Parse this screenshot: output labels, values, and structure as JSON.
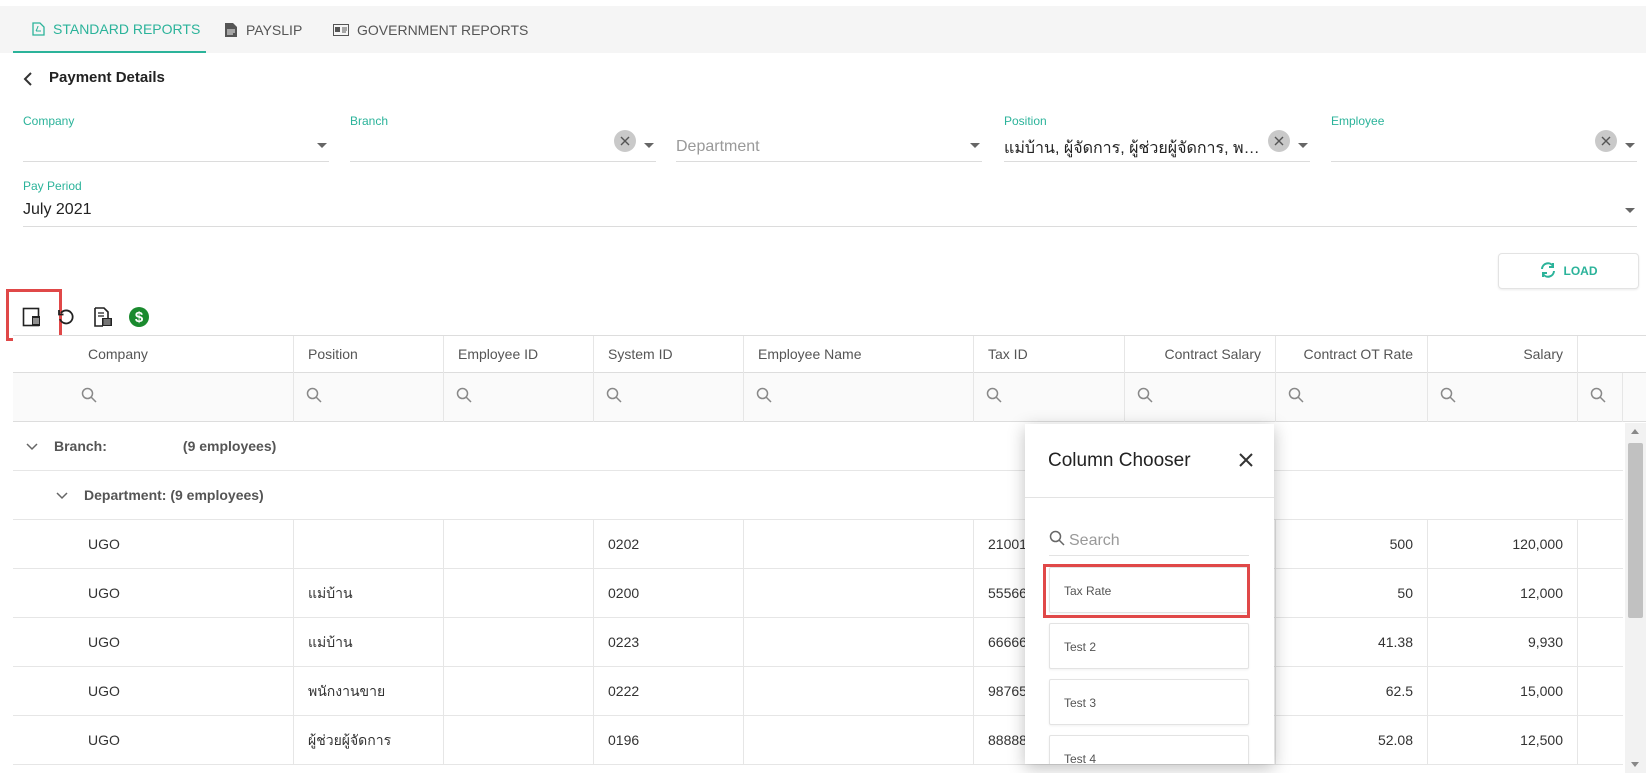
{
  "tabs": [
    {
      "label": "STANDARD REPORTS",
      "icon": "pdf-file-icon",
      "active": true
    },
    {
      "label": "PAYSLIP",
      "icon": "document-icon",
      "active": false
    },
    {
      "label": "GOVERNMENT REPORTS",
      "icon": "id-card-icon",
      "active": false
    }
  ],
  "header": {
    "title": "Payment Details"
  },
  "filters": {
    "company": {
      "label": "Company",
      "value": ""
    },
    "branch": {
      "label": "Branch",
      "value": ""
    },
    "department": {
      "placeholder": "Department"
    },
    "position": {
      "label": "Position",
      "value": "แม่บ้าน, ผู้จัดการ, ผู้ช่วยผู้จัดการ, พนักง…"
    },
    "employee": {
      "label": "Employee",
      "value": ""
    },
    "pay_period": {
      "label": "Pay Period",
      "value": "July 2021"
    }
  },
  "load_button": {
    "label": "LOAD"
  },
  "grid": {
    "columns": [
      "Company",
      "Position",
      "Employee ID",
      "System ID",
      "Employee Name",
      "Tax ID",
      "Contract Salary",
      "Contract OT Rate",
      "Salary"
    ],
    "group_branch": {
      "label": "Branch:",
      "count": "(9 employees)"
    },
    "group_department": {
      "label": "Department: (9 employees)"
    },
    "rows": [
      {
        "company": "UGO",
        "position": "",
        "employee_id": "",
        "system_id": "0202",
        "employee_name": "",
        "tax_id": "21001",
        "contract_salary": "",
        "ot_rate": "500",
        "salary": "120,000"
      },
      {
        "company": "UGO",
        "position": "แม่บ้าน",
        "employee_id": "",
        "system_id": "0200",
        "employee_name": "",
        "tax_id": "55566",
        "contract_salary": "",
        "ot_rate": "50",
        "salary": "12,000"
      },
      {
        "company": "UGO",
        "position": "แม่บ้าน",
        "employee_id": "",
        "system_id": "0223",
        "employee_name": "",
        "tax_id": "66666",
        "contract_salary": "",
        "ot_rate": "41.38",
        "salary": "9,930"
      },
      {
        "company": "UGO",
        "position": "พนักงานขาย",
        "employee_id": "",
        "system_id": "0222",
        "employee_name": "",
        "tax_id": "98765",
        "contract_salary": "",
        "ot_rate": "62.5",
        "salary": "15,000"
      },
      {
        "company": "UGO",
        "position": "ผู้ช่วยผู้จัดการ",
        "employee_id": "",
        "system_id": "0196",
        "employee_name": "",
        "tax_id": "88888",
        "contract_salary": "",
        "ot_rate": "52.08",
        "salary": "12,500"
      }
    ]
  },
  "column_chooser": {
    "title": "Column Chooser",
    "search_placeholder": "Search",
    "items": [
      "Tax Rate",
      "Test 2",
      "Test 3",
      "Test 4"
    ]
  },
  "colors": {
    "accent": "#2bb39a",
    "highlight": "#e04848",
    "dollar_icon": "#1a8a2e"
  }
}
